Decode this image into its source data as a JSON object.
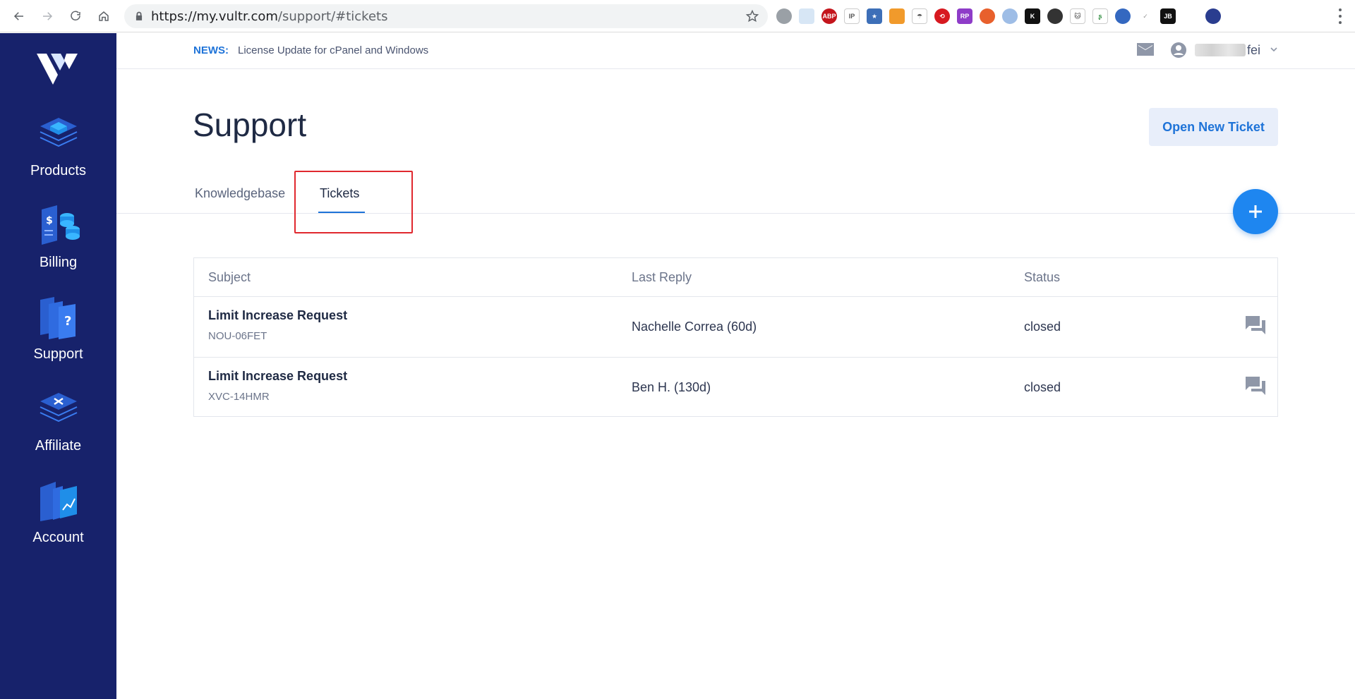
{
  "browser": {
    "url_host": "https://my.vultr.com",
    "url_path": "/support/#tickets"
  },
  "sidebar": {
    "items": [
      {
        "label": "Products",
        "icon": "products-icon"
      },
      {
        "label": "Billing",
        "icon": "billing-icon"
      },
      {
        "label": "Support",
        "icon": "support-icon"
      },
      {
        "label": "Affiliate",
        "icon": "affiliate-icon"
      },
      {
        "label": "Account",
        "icon": "account-icon"
      }
    ]
  },
  "header": {
    "news_tag": "NEWS:",
    "news_text": "License Update for cPanel and Windows",
    "user_name_visible": "fei"
  },
  "main": {
    "title": "Support",
    "open_ticket_label": "Open New Ticket",
    "tabs": [
      {
        "label": "Knowledgebase",
        "active": false
      },
      {
        "label": "Tickets",
        "active": true
      }
    ],
    "table": {
      "columns": [
        "Subject",
        "Last Reply",
        "Status"
      ],
      "rows": [
        {
          "subject": "Limit Increase Request",
          "id": "NOU-06FET",
          "last_reply": "Nachelle Correa (60d)",
          "status": "closed"
        },
        {
          "subject": "Limit Increase Request",
          "id": "XVC-14HMR",
          "last_reply": "Ben H. (130d)",
          "status": "closed"
        }
      ]
    }
  },
  "colors": {
    "sidebar_bg": "#17226b",
    "accent": "#1e73d8",
    "highlight_border": "#e0282e"
  }
}
